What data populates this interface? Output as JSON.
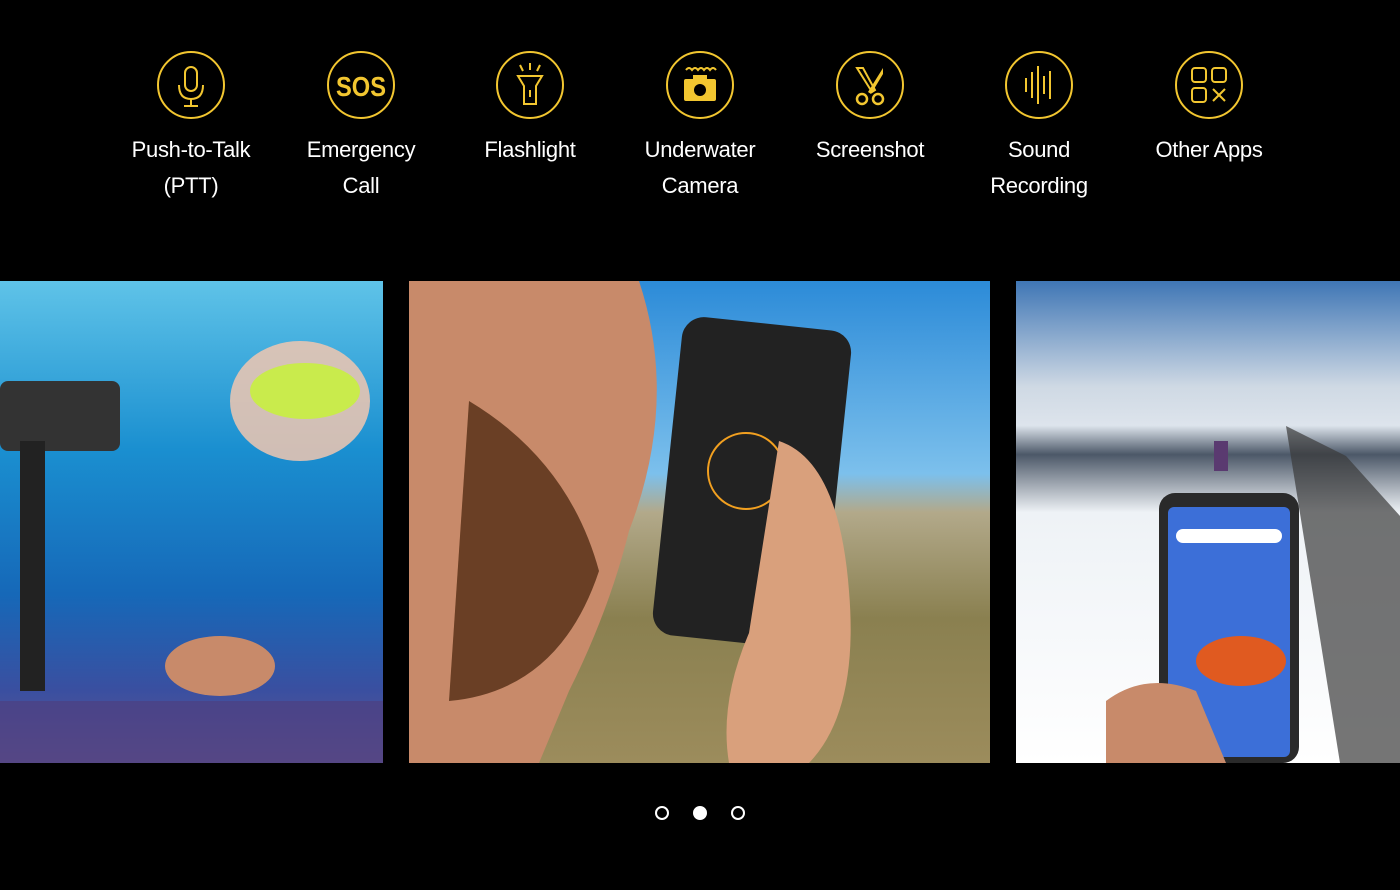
{
  "accent_color": "#f2c630",
  "features": [
    {
      "icon": "microphone-icon",
      "label_line1": "Push-to-Talk",
      "label_line2": "(PTT)"
    },
    {
      "icon": "sos-icon",
      "label_line1": "Emergency",
      "label_line2": "Call",
      "icon_text": "SOS"
    },
    {
      "icon": "flashlight-icon",
      "label_line1": "Flashlight",
      "label_line2": ""
    },
    {
      "icon": "underwater-camera-icon",
      "label_line1": "Underwater",
      "label_line2": "Camera"
    },
    {
      "icon": "scissors-icon",
      "label_line1": "Screenshot",
      "label_line2": ""
    },
    {
      "icon": "sound-wave-icon",
      "label_line1": "Sound",
      "label_line2": "Recording"
    },
    {
      "icon": "apps-grid-icon",
      "label_line1": "Other Apps",
      "label_line2": ""
    }
  ],
  "carousel": {
    "slides": [
      "underwater snorkeler filming with phone on gimbal",
      "man using push-to-talk app on phone",
      "hiker on snowy mountain, phone home screen"
    ],
    "active_index": 1,
    "dot_count": 3
  }
}
